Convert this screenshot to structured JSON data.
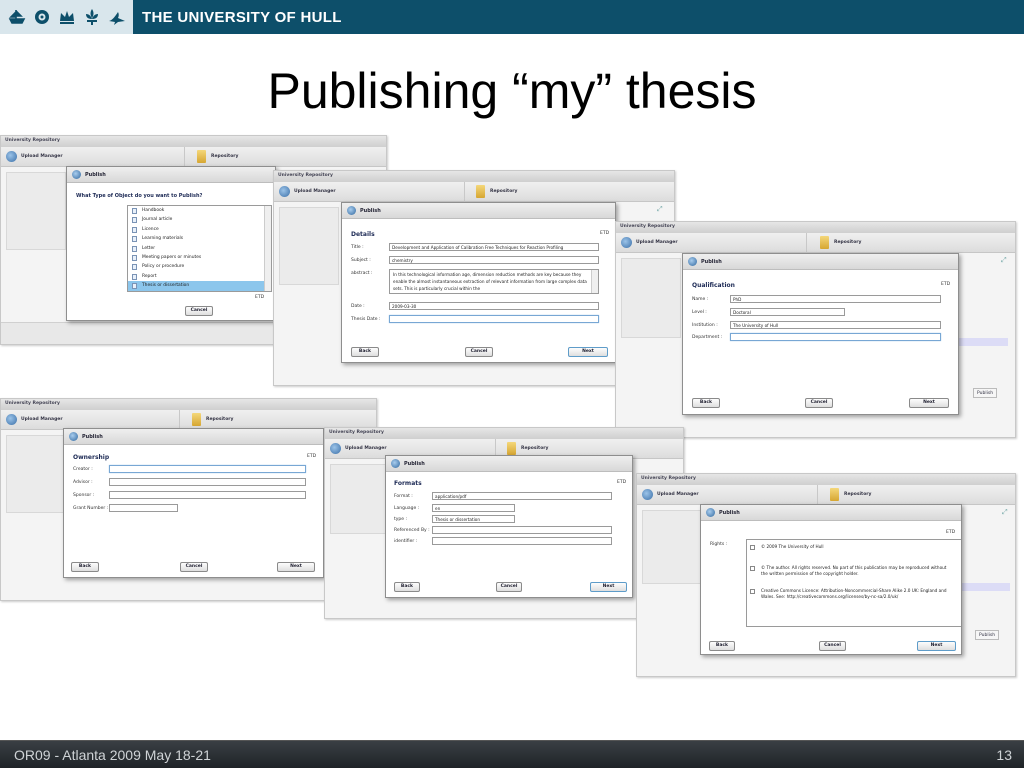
{
  "banner": {
    "university": "THE UNIVERSITY OF HULL"
  },
  "slide": {
    "title": "Publishing “my” thesis"
  },
  "footer": {
    "left": "OR09 - Atlanta 2009 May 18-21",
    "page": "13"
  },
  "app": {
    "window_title": "University Repository",
    "upload_manager": "Upload Manager",
    "repository": "Repository",
    "publish": "Publish",
    "etd": "ETD",
    "back": "Back",
    "cancel": "Cancel",
    "next": "Next"
  },
  "screen1": {
    "question": "What Type of Object do you want to Publish?",
    "object_types": [
      "Handbook",
      "Journal article",
      "Licence",
      "Learning materials",
      "Letter",
      "Meeting papers or minutes",
      "Policy or procedure",
      "Report",
      "Thesis or dissertation"
    ],
    "selected": "Thesis or dissertation"
  },
  "screen2": {
    "heading": "Details",
    "title_label": "Title :",
    "title_value": "Development and Application of Calibration Free Techniques for Reaction Profiling",
    "subject_label": "Subject :",
    "subject_value": "chemistry",
    "abstract_label": "abstract :",
    "abstract_value": "In this technological information age, dimension reduction methods are key because they enable the almost instantaneous extraction of relevant information from large complex data sets. This is particularly crucial within the",
    "date_label": "Date :",
    "date_value": "2009-03-30",
    "thesis_date_label": "Thesis Date :",
    "thesis_date_value": ""
  },
  "screen3": {
    "heading": "Qualification",
    "name_label": "Name :",
    "name_value": "PhD",
    "level_label": "Level :",
    "level_value": "Doctoral",
    "institution_label": "Institution :",
    "institution_value": "The University of Hull",
    "department_label": "Department :",
    "department_value": ""
  },
  "screen4": {
    "heading": "Ownership",
    "creator_label": "Creator :",
    "advisor_label": "Advisor :",
    "sponsor_label": "Sponsor :",
    "grant_label": "Grant Number :"
  },
  "screen5": {
    "heading": "Formats",
    "format_label": "Format :",
    "format_value": "application/pdf",
    "language_label": "Language :",
    "language_value": "en",
    "type_label": "type :",
    "type_value": "Thesis or dissertation",
    "referenced_label": "Referenced By :",
    "identifier_label": "identifier :"
  },
  "screen6": {
    "rights_label": "Rights :",
    "rights": [
      "© 2009 The University of Hull",
      "© The author. All rights reserved. No part of this publication may be reproduced without the written permission of the copyright holder.",
      "Creative Commons Licence: Attribution-Noncommercial-Share Alike 2.0 UK: England and Wales. See: http://creativecommons.org/licenses/by-nc-sa/2.0/uk/"
    ]
  }
}
